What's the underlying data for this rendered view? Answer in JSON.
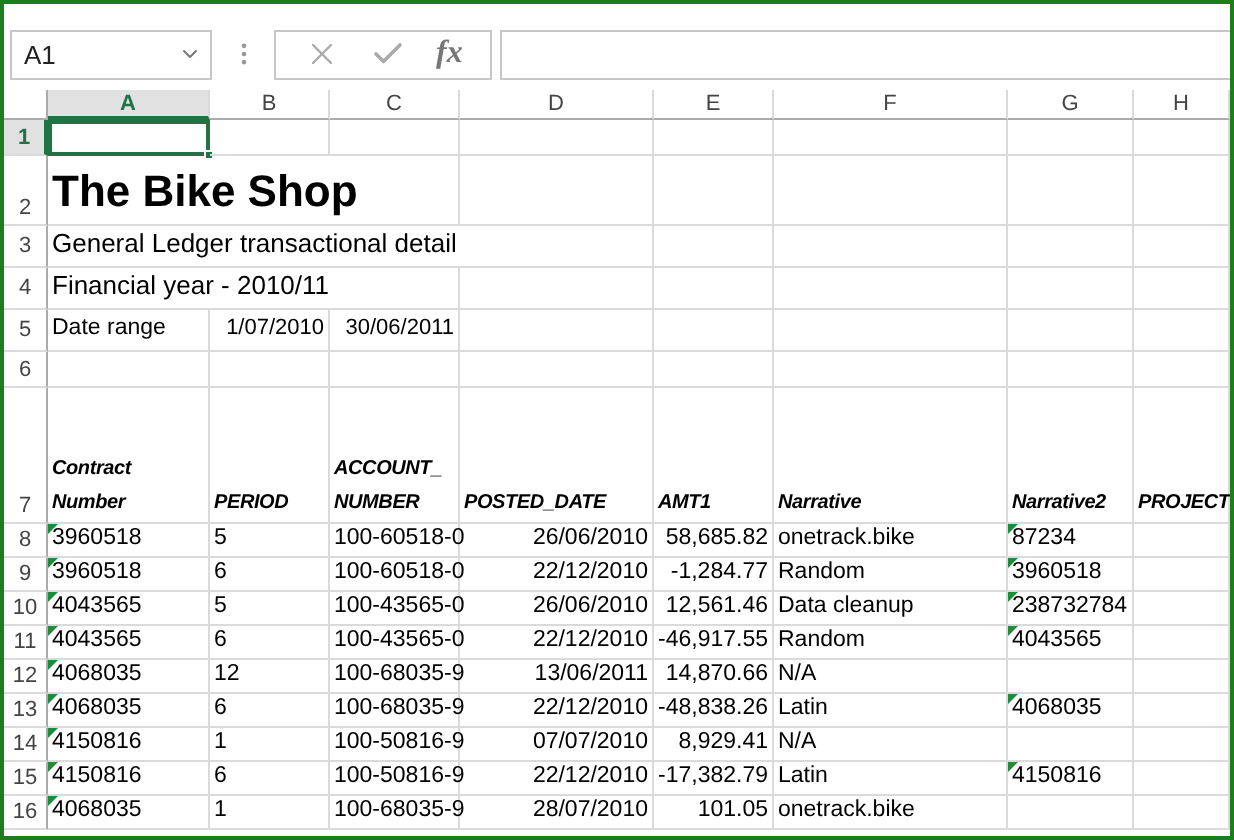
{
  "name_box": "A1",
  "formula_bar": {
    "function_label": "fx"
  },
  "columns": [
    {
      "label": "A",
      "selected": true
    },
    {
      "label": "B",
      "selected": false
    },
    {
      "label": "C",
      "selected": false
    },
    {
      "label": "D",
      "selected": false
    },
    {
      "label": "E",
      "selected": false
    },
    {
      "label": "F",
      "selected": false
    },
    {
      "label": "G",
      "selected": false
    },
    {
      "label": "H",
      "selected": false
    }
  ],
  "rows": [
    {
      "label": "1",
      "selected": true,
      "kind": "blank"
    },
    {
      "label": "2",
      "selected": false,
      "kind": "title",
      "text": "The Bike Shop"
    },
    {
      "label": "3",
      "selected": false,
      "kind": "line",
      "text": "General Ledger transactional detail"
    },
    {
      "label": "4",
      "selected": false,
      "kind": "line",
      "text": "Financial year - 2010/11"
    },
    {
      "label": "5",
      "selected": false,
      "kind": "range",
      "label_text": "Date range",
      "from": "1/07/2010",
      "to": "30/06/2011"
    },
    {
      "label": "6",
      "selected": false,
      "kind": "blank"
    },
    {
      "label": "7",
      "selected": false,
      "kind": "header",
      "cells": [
        "Contract Number",
        "PERIOD",
        "ACCOUNT_NUMBER",
        "POSTED_DATE",
        "AMT1",
        "Narrative",
        "Narrative2",
        "PROJECT"
      ]
    },
    {
      "label": "8",
      "selected": false,
      "kind": "data",
      "contract": {
        "text": "3960518",
        "warning": true
      },
      "period": "5",
      "account": "100-60518-0",
      "posted_date": "26/06/2010",
      "amt1": "58,685.82",
      "narrative": "onetrack.bike",
      "narrative2": {
        "text": "87234",
        "warning": true
      }
    },
    {
      "label": "9",
      "selected": false,
      "kind": "data",
      "contract": {
        "text": "3960518",
        "warning": true
      },
      "period": "6",
      "account": "100-60518-0",
      "posted_date": "22/12/2010",
      "amt1": "-1,284.77",
      "narrative": "Random",
      "narrative2": {
        "text": "3960518",
        "warning": true
      }
    },
    {
      "label": "10",
      "selected": false,
      "kind": "data",
      "contract": {
        "text": "4043565",
        "warning": true
      },
      "period": "5",
      "account": "100-43565-0",
      "posted_date": "26/06/2010",
      "amt1": "12,561.46",
      "narrative": "Data cleanup",
      "narrative2": {
        "text": "238732784",
        "warning": true
      }
    },
    {
      "label": "11",
      "selected": false,
      "kind": "data",
      "contract": {
        "text": "4043565",
        "warning": true
      },
      "period": "6",
      "account": "100-43565-0",
      "posted_date": "22/12/2010",
      "amt1": "-46,917.55",
      "narrative": "Random",
      "narrative2": {
        "text": "4043565",
        "warning": true
      }
    },
    {
      "label": "12",
      "selected": false,
      "kind": "data",
      "contract": {
        "text": "4068035",
        "warning": true
      },
      "period": "12",
      "account": "100-68035-9",
      "posted_date": "13/06/2011",
      "amt1": "14,870.66",
      "narrative": "N/A"
    },
    {
      "label": "13",
      "selected": false,
      "kind": "data",
      "contract": {
        "text": "4068035",
        "warning": true
      },
      "period": "6",
      "account": "100-68035-9",
      "posted_date": "22/12/2010",
      "amt1": "-48,838.26",
      "narrative": "Latin",
      "narrative2": {
        "text": "4068035",
        "warning": true
      }
    },
    {
      "label": "14",
      "selected": false,
      "kind": "data",
      "contract": {
        "text": "4150816",
        "warning": true
      },
      "period": "1",
      "account": "100-50816-9",
      "posted_date": "07/07/2010",
      "amt1": "8,929.41",
      "narrative": "N/A"
    },
    {
      "label": "15",
      "selected": false,
      "kind": "data",
      "contract": {
        "text": "4150816",
        "warning": true
      },
      "period": "6",
      "account": "100-50816-9",
      "posted_date": "22/12/2010",
      "amt1": "-17,382.79",
      "narrative": "Latin",
      "narrative2": {
        "text": "4150816",
        "warning": true
      }
    },
    {
      "label": "16",
      "selected": false,
      "kind": "data",
      "contract": {
        "text": "4068035",
        "warning": true
      },
      "period": "1",
      "account": "100-68035-9",
      "posted_date": "28/07/2010",
      "amt1": "101.05",
      "narrative": "onetrack.bike"
    }
  ]
}
